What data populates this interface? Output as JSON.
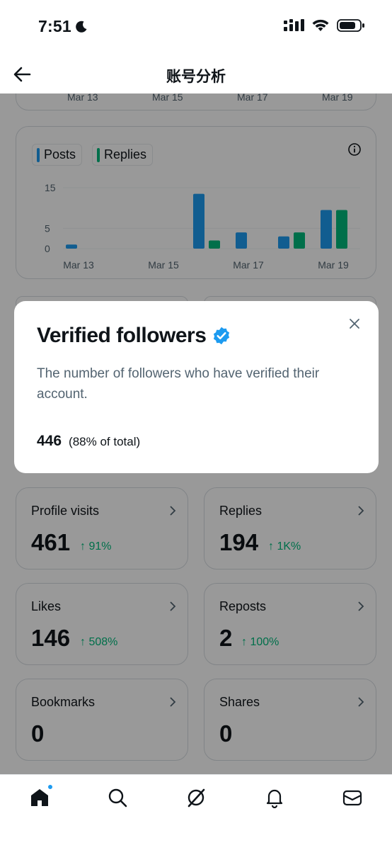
{
  "status_bar": {
    "time": "7:51",
    "icons": [
      "moon-icon",
      "signal-icon",
      "wifi-icon",
      "battery-icon"
    ]
  },
  "header": {
    "title": "账号分析",
    "back_icon": "arrow-left-icon"
  },
  "prev_chart": {
    "x_ticks": [
      "Mar 13",
      "Mar 15",
      "Mar 17",
      "Mar 19"
    ]
  },
  "chart_data": {
    "type": "bar",
    "legend": [
      "Posts",
      "Replies"
    ],
    "y_ticks": [
      "15",
      "5",
      "0"
    ],
    "x_ticks": [
      "Mar 13",
      "Mar 15",
      "Mar 17",
      "Mar 19"
    ],
    "categories": [
      "Mar 13",
      "Mar 14",
      "Mar 15",
      "Mar 16",
      "Mar 17",
      "Mar 18",
      "Mar 19"
    ],
    "series": [
      {
        "name": "Posts",
        "color": "#1d9bf0",
        "values": [
          1,
          0,
          0,
          13.5,
          4,
          3,
          9.5
        ]
      },
      {
        "name": "Replies",
        "color": "#00ba7c",
        "values": [
          0,
          0,
          0,
          2,
          0,
          4,
          9.5
        ]
      }
    ],
    "ylim": [
      0,
      15
    ]
  },
  "stats": [
    {
      "label": "Profile visits",
      "value": "461",
      "change": "↑ 91%"
    },
    {
      "label": "Replies",
      "value": "194",
      "change": "↑ 1K%"
    },
    {
      "label": "Likes",
      "value": "146",
      "change": "↑ 508%"
    },
    {
      "label": "Reposts",
      "value": "2",
      "change": "↑ 100%"
    },
    {
      "label": "Bookmarks",
      "value": "0",
      "change": ""
    },
    {
      "label": "Shares",
      "value": "0",
      "change": ""
    }
  ],
  "modal": {
    "title": "Verified followers",
    "badge_icon": "verified-badge-icon",
    "description": "The number of followers who have verified their account.",
    "count": "446",
    "percent": "(88% of total)",
    "close_icon": "close-icon"
  },
  "nav": [
    "home-icon",
    "search-icon",
    "grok-icon",
    "notifications-icon",
    "messages-icon"
  ],
  "colors": {
    "accent": "#1d9bf0",
    "positive": "#00ba7c",
    "muted": "#536471"
  }
}
